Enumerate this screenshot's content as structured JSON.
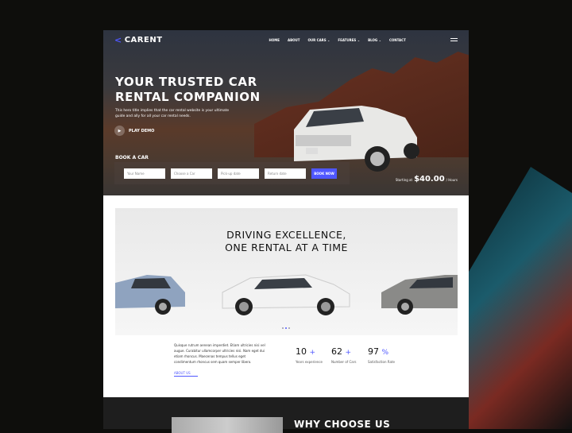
{
  "nav": {
    "logo": "CARENT",
    "items": [
      "HOME",
      "ABOUT",
      "OUR CARS ⌄",
      "FEATURES ⌄",
      "BLOG ⌄",
      "CONTACT"
    ]
  },
  "hero": {
    "title_line1": "YOUR TRUSTED CAR",
    "title_line2": "RENTAL COMPANION",
    "subtitle": "This hero title implies that the car rental website is your ultimate guide and ally for all your car rental needs.",
    "play": "PLAY DEMO",
    "book_title": "BOOK A CAR",
    "fields": [
      "Your Name",
      "Choose a Car",
      "Pick-up date",
      "Return date"
    ],
    "book_button": "BOOK NOW",
    "price_prefix": "Starting at",
    "price": "$40.00",
    "price_suffix": "/ Hours"
  },
  "section": {
    "title_line1": "DRIVING EXCELLENCE,",
    "title_line2": "ONE RENTAL AT A TIME",
    "paragraph": "Quisque rutrum aenean imperdiet. Etiam ultricies nisi vel augue. Curabitur ullamcorper ultricies nisi. Nam eget dui etiam rhoncus. Maecenas tempus tellus eget condimentum rhoncus sem quam semper libero.",
    "about_link": "ABOUT US",
    "stats": [
      {
        "value": "10",
        "suffix": "+",
        "label": "Years experience"
      },
      {
        "value": "62",
        "suffix": "+",
        "label": "Number of Cars"
      },
      {
        "value": "97",
        "suffix": "%",
        "label": "Satisfaction Rate"
      }
    ]
  },
  "why": {
    "title": "WHY CHOOSE US"
  },
  "colors": {
    "accent": "#4f57ff"
  }
}
